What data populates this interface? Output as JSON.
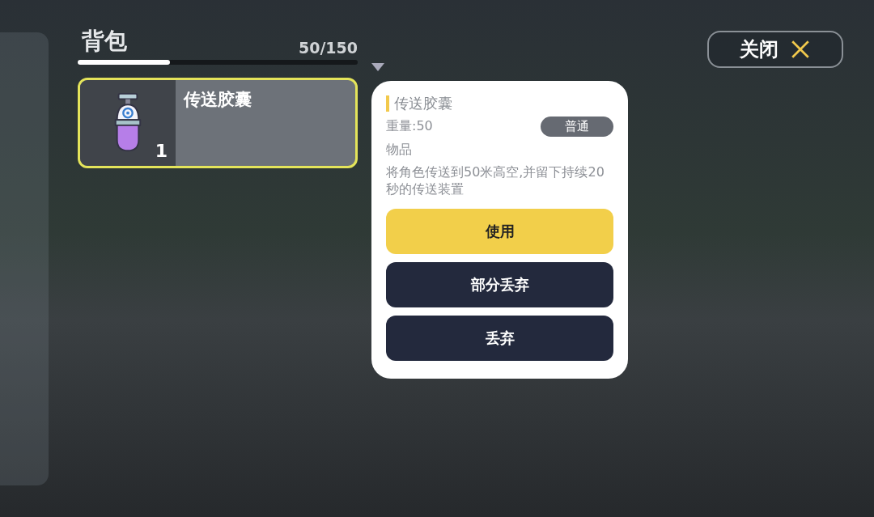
{
  "backpack": {
    "title": "背包",
    "capacity": "50/150",
    "level": 0.33
  },
  "items": [
    {
      "name": "传送胶囊",
      "count": "1",
      "selected": true
    }
  ],
  "detail": {
    "name": "传送胶囊",
    "weight": "重量:50",
    "rarity": "普通",
    "category": "物品",
    "description": "将角色传送到50米高空,并留下持续20秒的传送装置",
    "actions": [
      {
        "label": "使用",
        "kind": "primary"
      },
      {
        "label": "部分丢弃",
        "kind": "secondary"
      },
      {
        "label": "丢弃",
        "kind": "secondary"
      }
    ]
  },
  "close_button": {
    "label": "关闭"
  }
}
